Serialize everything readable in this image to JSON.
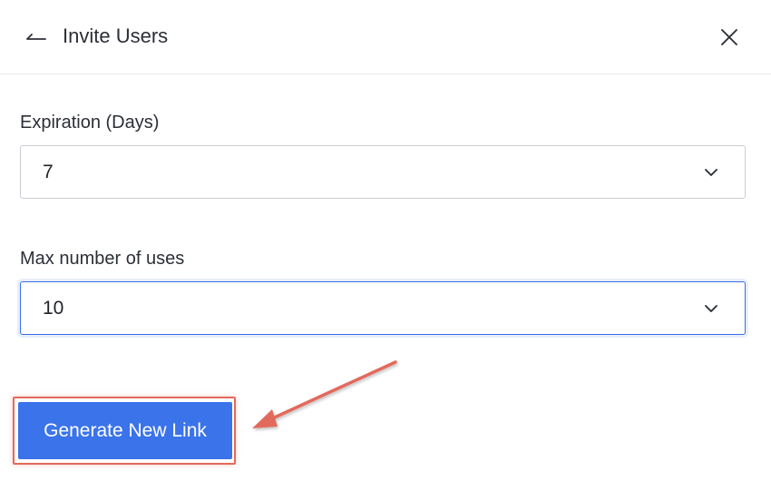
{
  "header": {
    "title": "Invite Users",
    "back_icon": "back-arrow-icon",
    "close_icon": "close-icon"
  },
  "form": {
    "expiration": {
      "label": "Expiration (Days)",
      "value": "7"
    },
    "max_uses": {
      "label": "Max number of uses",
      "value": "10",
      "focused": true
    }
  },
  "actions": {
    "generate_label": "Generate New Link"
  },
  "colors": {
    "primary": "#3a73ea",
    "focus_border": "#3a6fe6",
    "annotation": "#e26a5c",
    "text": "#2b2f36"
  }
}
